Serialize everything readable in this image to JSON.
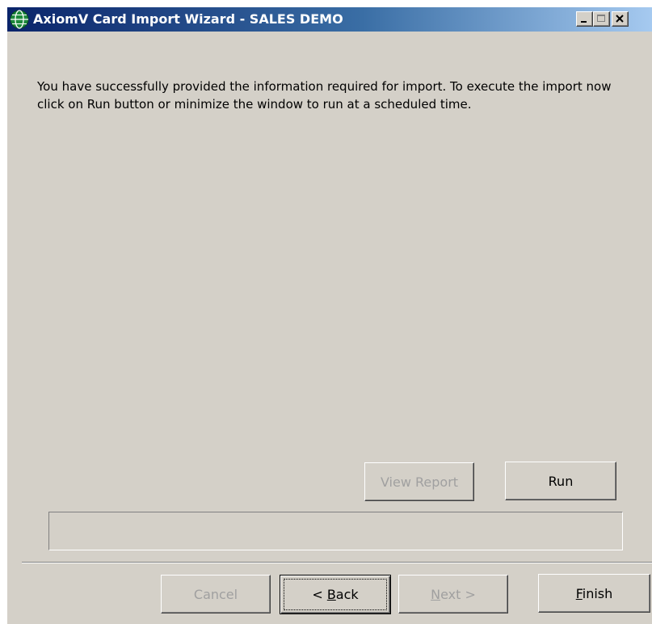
{
  "window": {
    "title": "AxiomV Card Import Wizard - SALES DEMO"
  },
  "titlebar_buttons": {
    "minimize": "minimize-icon",
    "maximize": "maximize-icon",
    "close": "close-icon"
  },
  "message": {
    "text": "You have successfully provided the information required for import. To execute the import now click on Run button or minimize the window to run at a scheduled time."
  },
  "actions": {
    "view_report_label": "View Report",
    "view_report_enabled": false,
    "run_label": "Run",
    "run_enabled": true
  },
  "progress": {
    "value": 0
  },
  "nav": {
    "cancel_label": "Cancel",
    "cancel_enabled": false,
    "back_prefix": "< ",
    "back_mnemonic": "B",
    "back_rest": "ack",
    "back_enabled": true,
    "next_mnemonic": "N",
    "next_rest": "ext >",
    "next_enabled": false,
    "finish_mnemonic": "F",
    "finish_rest": "inish",
    "finish_enabled": true
  },
  "colors": {
    "dialog_bg": "#d4d0c8",
    "title_gradient_start": "#0a246a",
    "title_gradient_end": "#a6caf0",
    "disabled_text": "#a0a0a0",
    "icon_green": "#1e8a3c"
  },
  "icons": {
    "app": "globe-icon"
  }
}
